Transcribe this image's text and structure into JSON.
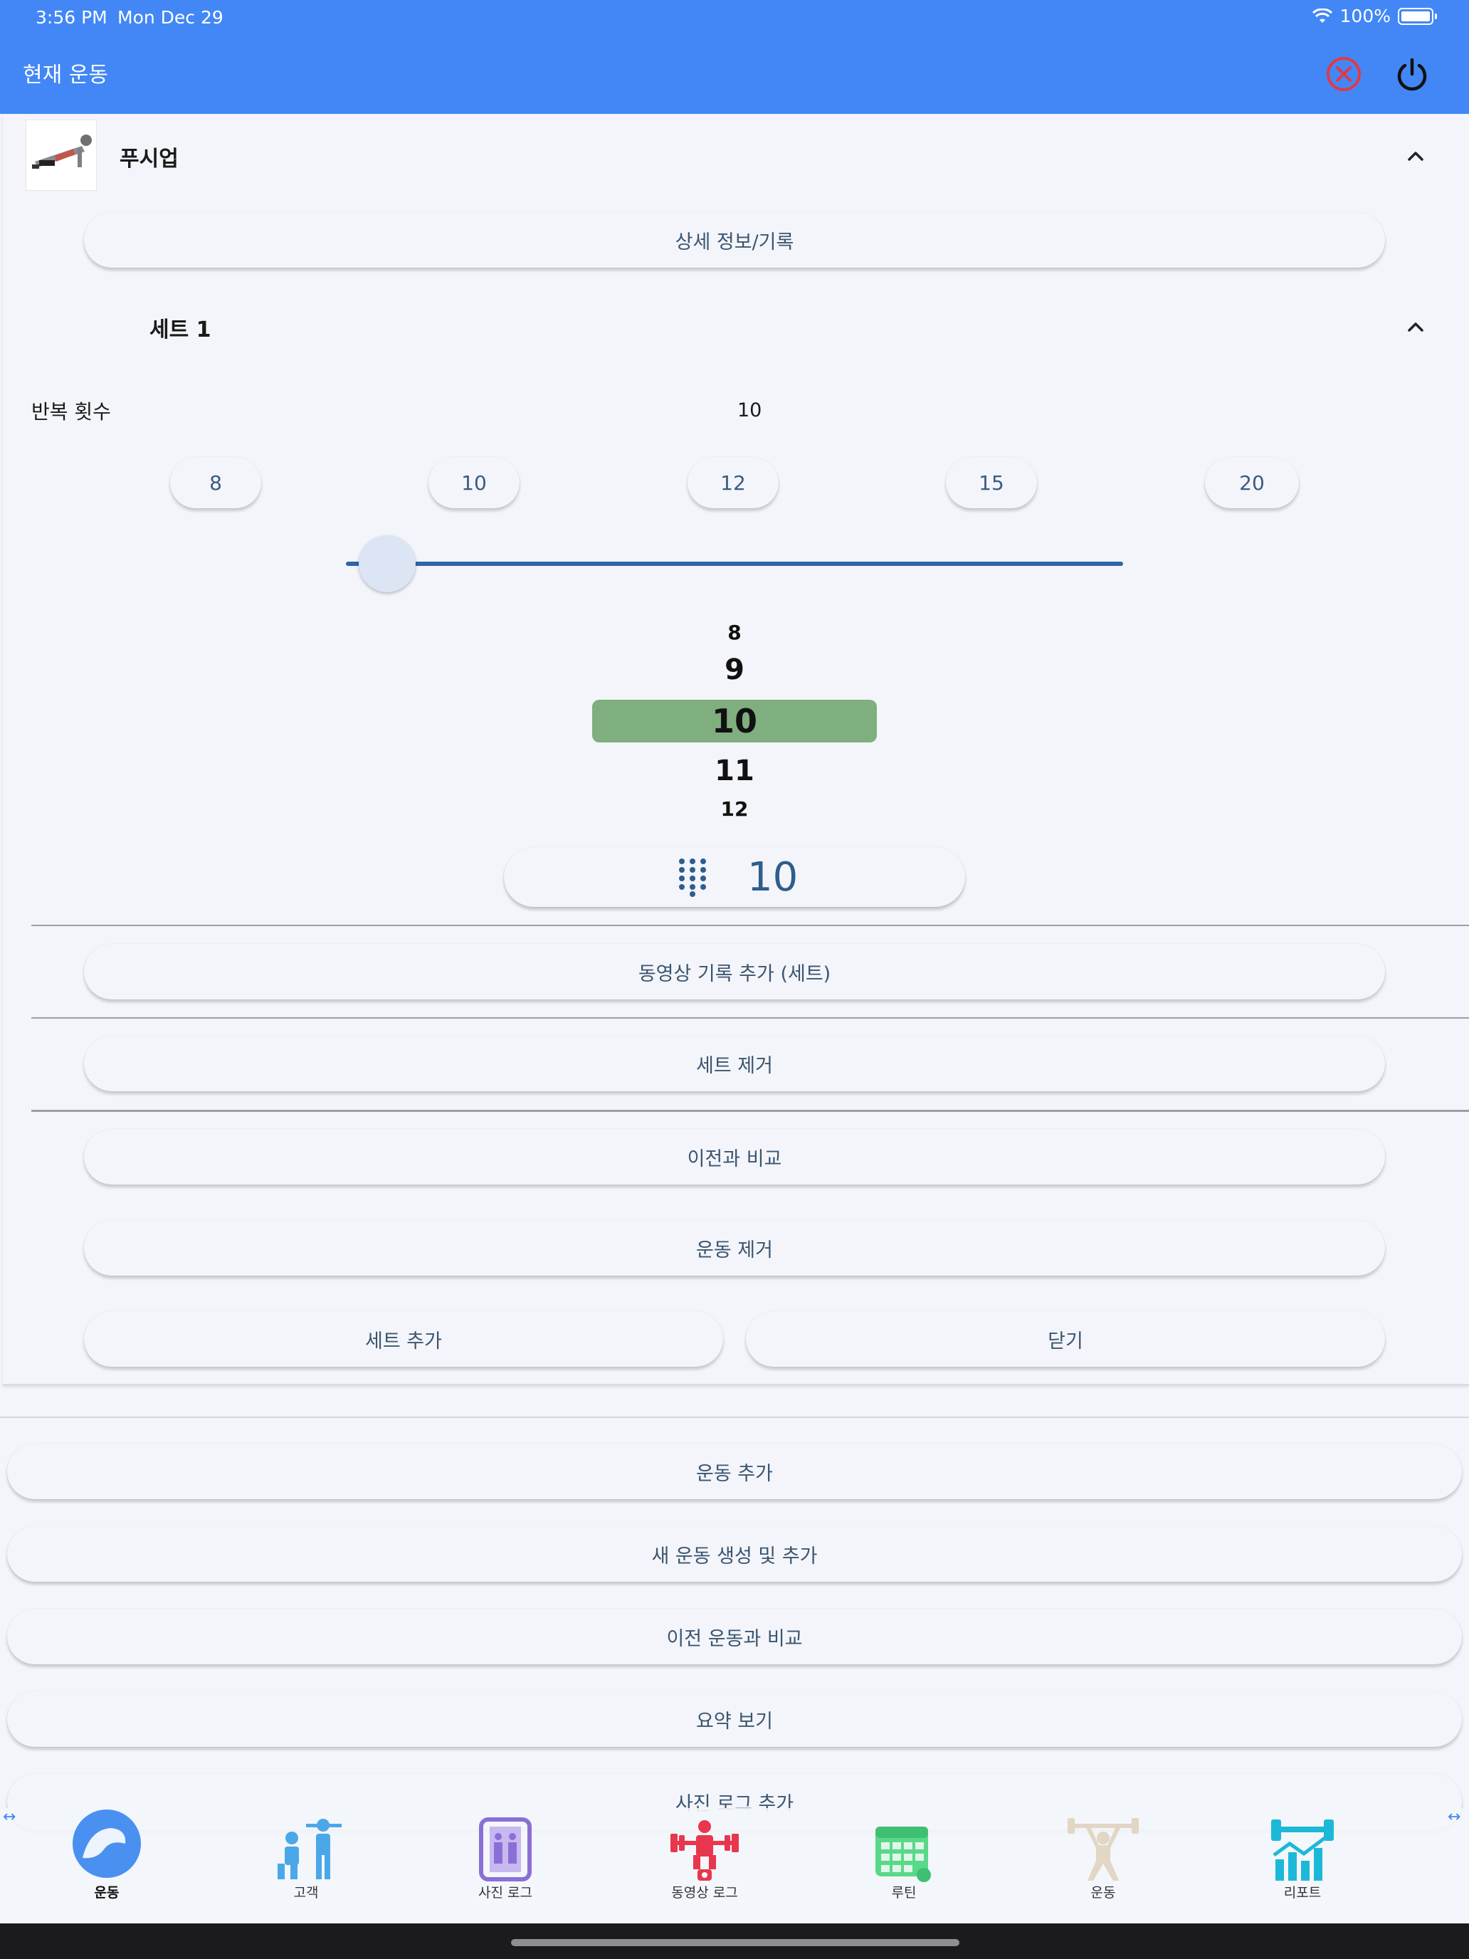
{
  "status": {
    "time": "3:56 PM",
    "date": "Mon Dec 29",
    "battery": "100%"
  },
  "appbar": {
    "title": "현재 운동"
  },
  "exercise": {
    "name": "푸시업",
    "detail_button": "상세 정보/기록",
    "set_title": "세트 1",
    "reps_label": "반복 횟수",
    "reps_value": "10",
    "quick_values": [
      "8",
      "10",
      "12",
      "15",
      "20"
    ],
    "slider_fraction": 0.0,
    "wheel": [
      "8",
      "9",
      "10",
      "11",
      "12"
    ],
    "keypad_value": "10",
    "add_video_button": "동영상 기록 추가 (세트)",
    "remove_set_button": "세트 제거",
    "compare_button": "이전과 비교",
    "remove_exercise_button": "운동 제거",
    "add_set_button": "세트 추가",
    "close_button": "닫기"
  },
  "actions": {
    "add_exercise": "운동 추가",
    "create_exercise": "새 운동 생성 및 추가",
    "compare_previous": "이전 운동과 비교",
    "summary": "요약 보기",
    "add_photo_log": "사진 로그 추가"
  },
  "nav": {
    "items": [
      {
        "label": "운동",
        "icon": "flexed-bicep-icon",
        "color": "#4a90f0",
        "active": true
      },
      {
        "label": "고객",
        "icon": "trainer-client-icon",
        "color": "#4aa8e8",
        "active": false
      },
      {
        "label": "사진 로그",
        "icon": "photo-mirror-icon",
        "color": "#8b6fd6",
        "active": false
      },
      {
        "label": "동영상 로그",
        "icon": "weightlifter-video-icon",
        "color": "#e8364f",
        "active": false
      },
      {
        "label": "루틴",
        "icon": "calendar-icon",
        "color": "#5ad88a",
        "active": false
      },
      {
        "label": "운동",
        "icon": "barbell-person-icon",
        "color": "#e2d6c4",
        "active": false
      },
      {
        "label": "리포트",
        "icon": "dumbbell-chart-icon",
        "color": "#1cb8d8",
        "active": false
      }
    ]
  }
}
